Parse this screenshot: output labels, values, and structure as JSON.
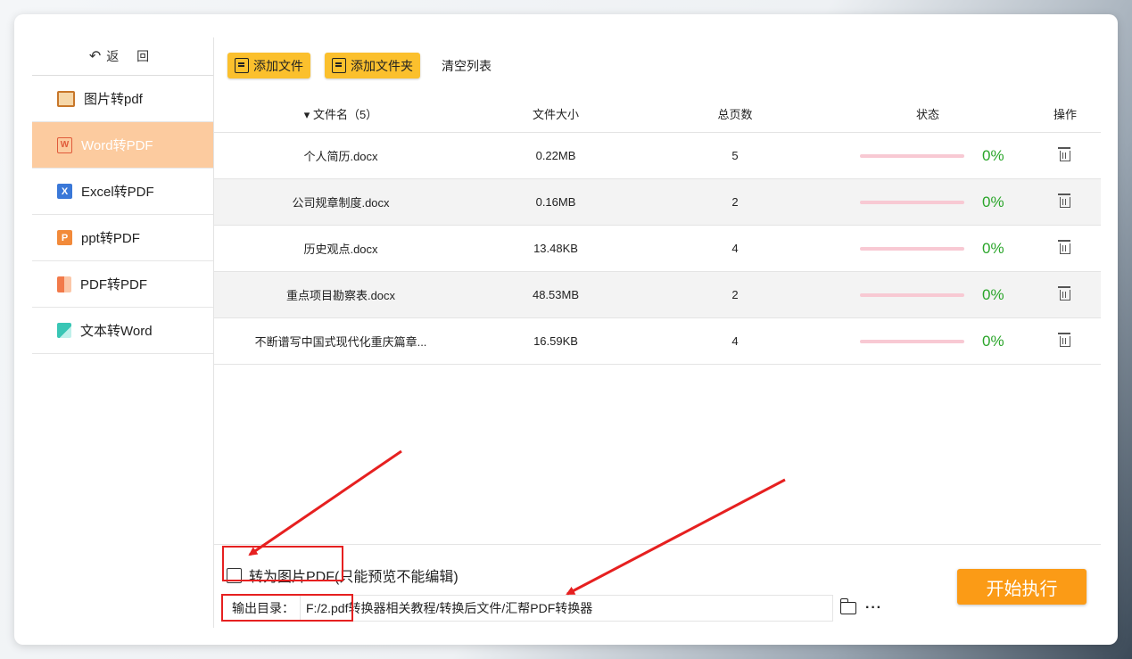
{
  "sidebar": {
    "back_label": "返 回",
    "items": [
      {
        "label": "图片转pdf",
        "icon": "image-icon",
        "active": false
      },
      {
        "label": "Word转PDF",
        "icon": "word-icon",
        "active": true
      },
      {
        "label": "Excel转PDF",
        "icon": "excel-icon",
        "active": false
      },
      {
        "label": "ppt转PDF",
        "icon": "ppt-icon",
        "active": false
      },
      {
        "label": "PDF转PDF",
        "icon": "pdf-icon",
        "active": false
      },
      {
        "label": "文本转Word",
        "icon": "text-icon",
        "active": false
      }
    ]
  },
  "toolbar": {
    "add_file": "添加文件",
    "add_folder": "添加文件夹",
    "clear_list": "清空列表"
  },
  "table": {
    "headers": {
      "name": "文件名（5）",
      "size": "文件大小",
      "pages": "总页数",
      "status": "状态",
      "action": "操作"
    },
    "rows": [
      {
        "name": "个人简历.docx",
        "size": "0.22MB",
        "pages": "5",
        "progress": "0%"
      },
      {
        "name": "公司规章制度.docx",
        "size": "0.16MB",
        "pages": "2",
        "progress": "0%"
      },
      {
        "name": "历史观点.docx",
        "size": "13.48KB",
        "pages": "4",
        "progress": "0%"
      },
      {
        "name": "重点项目勘察表.docx",
        "size": "48.53MB",
        "pages": "2",
        "progress": "0%"
      },
      {
        "name": "不断谱写中国式现代化重庆篇章...",
        "size": "16.59KB",
        "pages": "4",
        "progress": "0%"
      }
    ]
  },
  "options": {
    "to_image_pdf_label": "转为图片PDF(只能预览不能编辑)",
    "to_image_pdf_checked": false
  },
  "output": {
    "label": "输出目录：",
    "path": "F:/2.pdf转换器相关教程/转换后文件/汇帮PDF转换器",
    "more": "···"
  },
  "run_button": "开始执行",
  "colors": {
    "accent_orange": "#fb9b16",
    "toolbar_yellow": "#fbc02d",
    "active_nav": "#fccb9f",
    "progress_green": "#2aa52a",
    "annotation_red": "#e62020"
  }
}
